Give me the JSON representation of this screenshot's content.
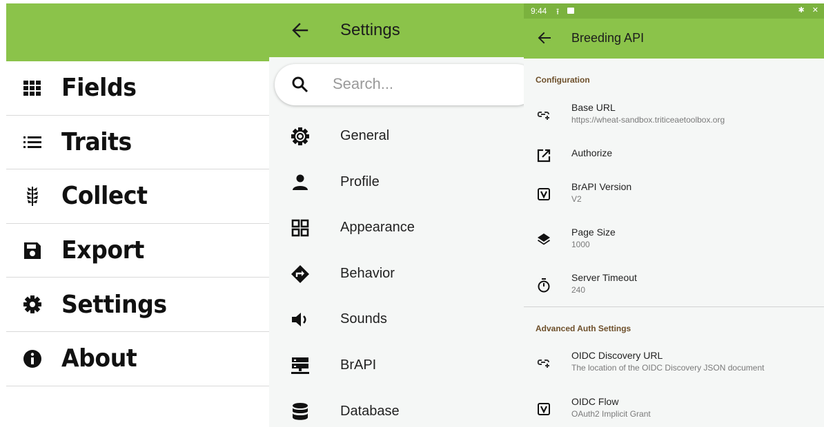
{
  "main_menu": {
    "items": [
      {
        "label": "Fields",
        "icon": "grid-icon"
      },
      {
        "label": "Traits",
        "icon": "list-icon"
      },
      {
        "label": "Collect",
        "icon": "wheat-icon"
      },
      {
        "label": "Export",
        "icon": "save-icon"
      },
      {
        "label": "Settings",
        "icon": "gear-icon"
      },
      {
        "label": "About",
        "icon": "info-icon"
      }
    ]
  },
  "settings": {
    "title": "Settings",
    "search_placeholder": "Search...",
    "items": [
      {
        "label": "General",
        "icon": "gear-outline-icon"
      },
      {
        "label": "Profile",
        "icon": "person-icon"
      },
      {
        "label": "Appearance",
        "icon": "dashboard-icon"
      },
      {
        "label": "Behavior",
        "icon": "directions-icon"
      },
      {
        "label": "Sounds",
        "icon": "volume-icon"
      },
      {
        "label": "BrAPI",
        "icon": "server-icon"
      },
      {
        "label": "Database",
        "icon": "database-icon"
      }
    ]
  },
  "brapi": {
    "status_time": "9:44",
    "title": "Breeding API",
    "configuration_header": "Configuration",
    "configuration": [
      {
        "title": "Base URL",
        "subtitle": "https://wheat-sandbox.triticeaetoolbox.org",
        "icon": "link-add-icon"
      },
      {
        "title": "Authorize",
        "subtitle": "",
        "icon": "open-in-new-icon"
      },
      {
        "title": "BrAPI Version",
        "subtitle": "V2",
        "icon": "version-badge-icon"
      },
      {
        "title": "Page Size",
        "subtitle": "1000",
        "icon": "layers-icon"
      },
      {
        "title": "Server Timeout",
        "subtitle": "240",
        "icon": "timer-icon"
      }
    ],
    "advanced_header": "Advanced Auth Settings",
    "advanced": [
      {
        "title": "OIDC Discovery URL",
        "subtitle": "The location of the OIDC Discovery JSON document",
        "icon": "link-add-icon"
      },
      {
        "title": "OIDC Flow",
        "subtitle": "OAuth2 Implicit Grant",
        "icon": "version-badge-icon"
      }
    ]
  },
  "colors": {
    "accent": "#8bc34a",
    "section_header": "#6d4f2a"
  }
}
